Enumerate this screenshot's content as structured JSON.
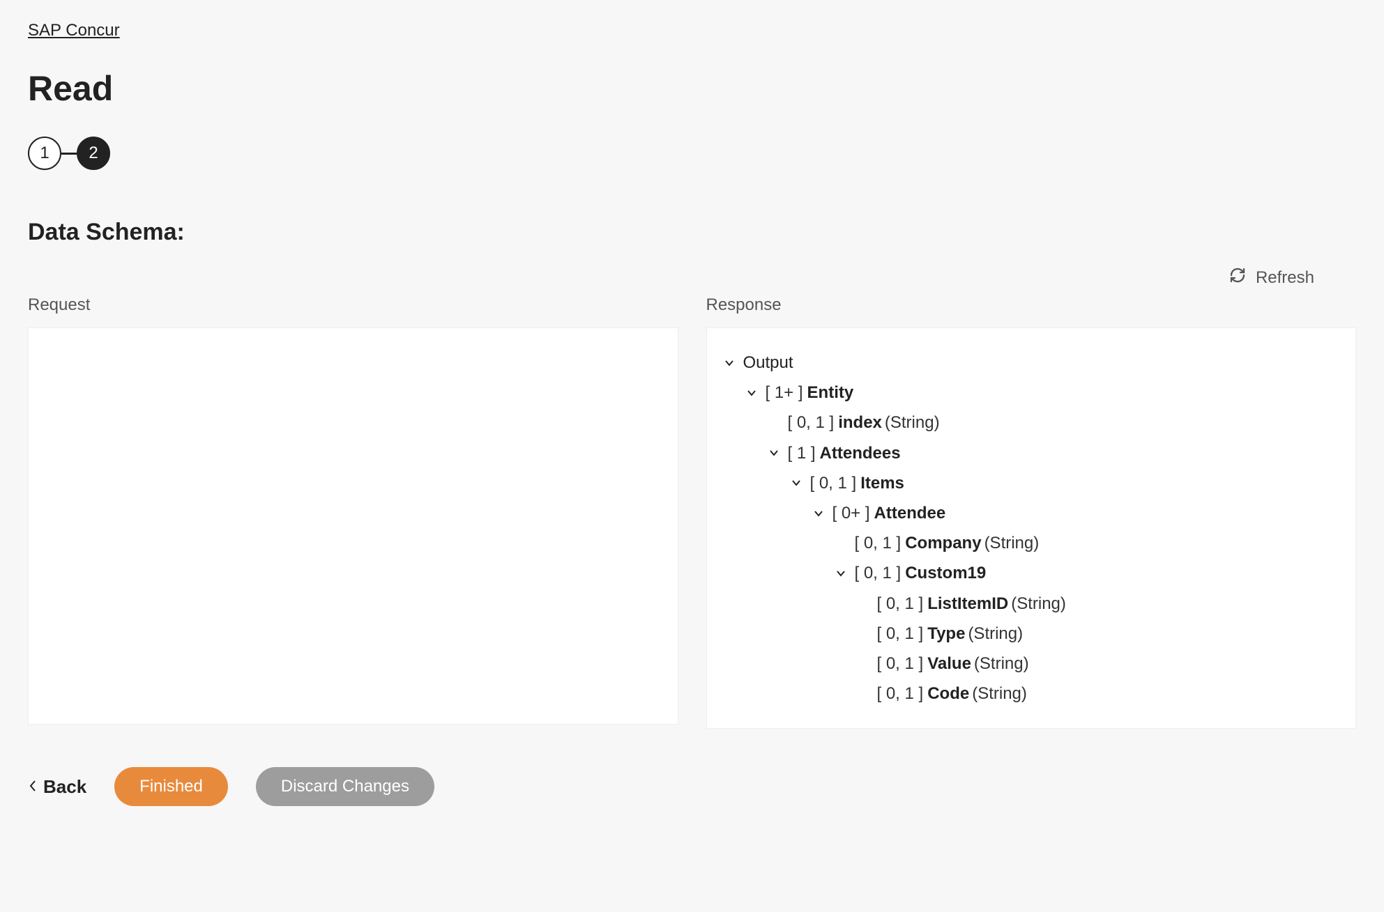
{
  "breadcrumb": {
    "label": "SAP Concur"
  },
  "page": {
    "title": "Read"
  },
  "stepper": {
    "step1": "1",
    "step2": "2"
  },
  "section": {
    "title": "Data Schema:"
  },
  "toolbar": {
    "refresh_label": "Refresh"
  },
  "columns": {
    "request": {
      "header": "Request"
    },
    "response": {
      "header": "Response"
    }
  },
  "tree": {
    "output": {
      "label": "Output"
    },
    "entity": {
      "cardinality": "[ 1+ ]",
      "label": "Entity"
    },
    "index": {
      "cardinality": "[ 0, 1 ]",
      "label": "index",
      "type": "(String)"
    },
    "attendees": {
      "cardinality": "[ 1 ]",
      "label": "Attendees"
    },
    "items": {
      "cardinality": "[ 0, 1 ]",
      "label": "Items"
    },
    "attendee": {
      "cardinality": "[ 0+ ]",
      "label": "Attendee"
    },
    "company": {
      "cardinality": "[ 0, 1 ]",
      "label": "Company",
      "type": "(String)"
    },
    "custom19": {
      "cardinality": "[ 0, 1 ]",
      "label": "Custom19"
    },
    "listitemid": {
      "cardinality": "[ 0, 1 ]",
      "label": "ListItemID",
      "type": "(String)"
    },
    "typefield": {
      "cardinality": "[ 0, 1 ]",
      "label": "Type",
      "type": "(String)"
    },
    "valuefield": {
      "cardinality": "[ 0, 1 ]",
      "label": "Value",
      "type": "(String)"
    },
    "codefield": {
      "cardinality": "[ 0, 1 ]",
      "label": "Code",
      "type": "(String)"
    }
  },
  "footer": {
    "back_label": "Back",
    "finished_label": "Finished",
    "discard_label": "Discard Changes"
  }
}
